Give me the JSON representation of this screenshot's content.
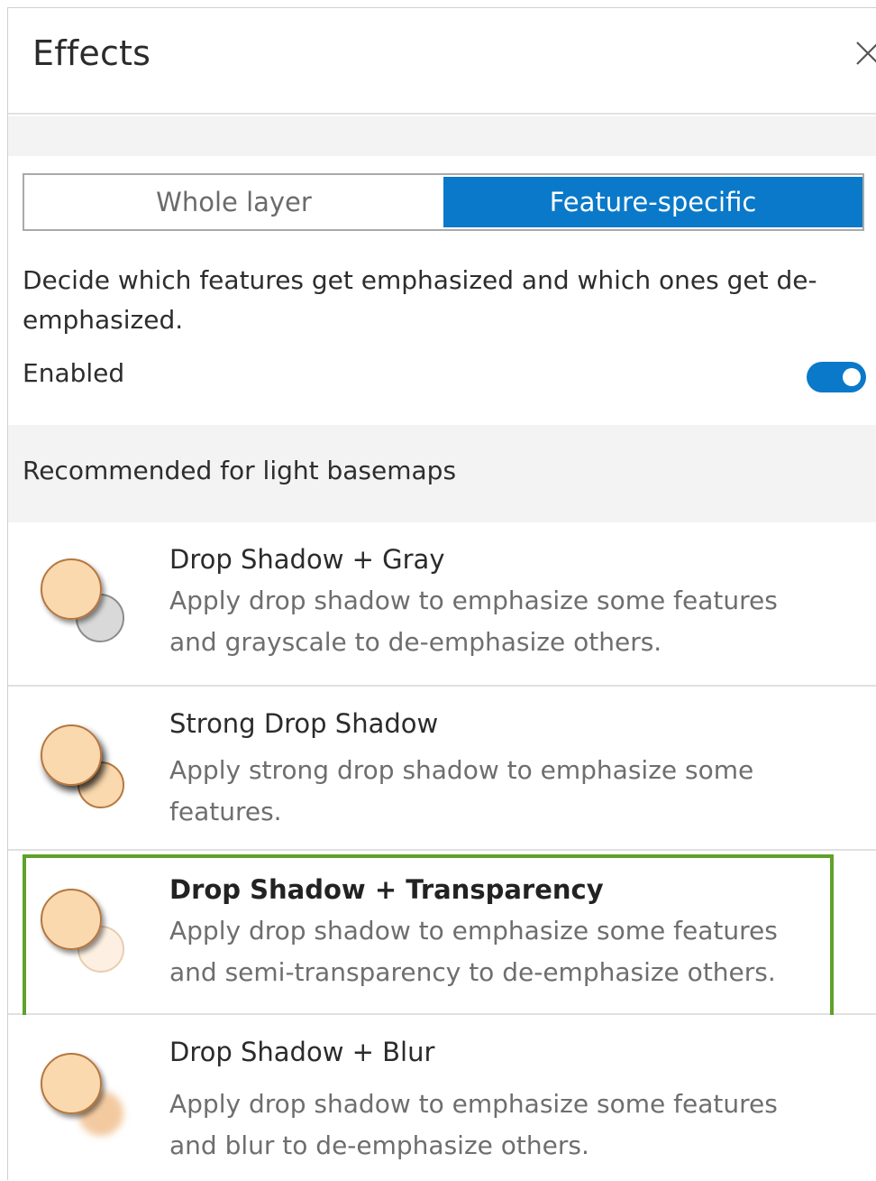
{
  "panel": {
    "title": "Effects",
    "close_icon": "close-icon"
  },
  "tabs": [
    {
      "label": "Whole layer",
      "active": false
    },
    {
      "label": "Feature-specific",
      "active": true
    }
  ],
  "description": "Decide which features get emphasized and which ones get de-emphasized.",
  "enabled": {
    "label": "Enabled",
    "value": true
  },
  "group": {
    "label": "Recommended for light basemaps"
  },
  "effects": [
    {
      "title": "Drop Shadow + Gray",
      "description": "Apply drop shadow to emphasize some features and grayscale to de-emphasize others.",
      "selected": false
    },
    {
      "title": "Strong Drop Shadow",
      "description": "Apply strong drop shadow to emphasize some features.",
      "selected": false
    },
    {
      "title": "Drop Shadow + Transparency",
      "description": "Apply drop shadow to emphasize some features and semi-transparency to de-emphasize others.",
      "selected": true
    },
    {
      "title": "Drop Shadow + Blur",
      "description": "Apply drop shadow to emphasize some features and blur to de-emphasize others.",
      "selected": false
    }
  ],
  "colors": {
    "accent": "#0a79c9",
    "selection_border": "#5fa12b",
    "circle_fill": "#fbd9ae",
    "circle_stroke": "#b5773f"
  }
}
